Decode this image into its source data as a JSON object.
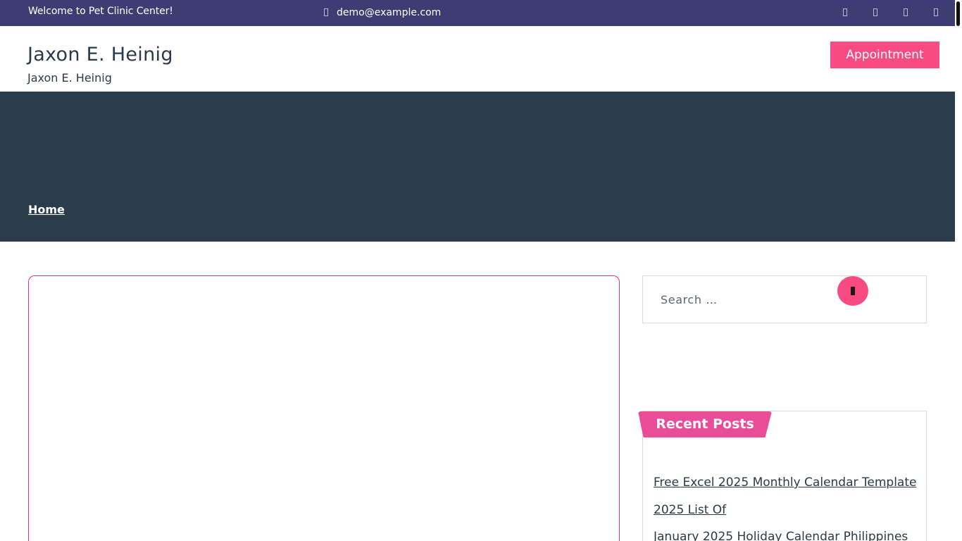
{
  "topbar": {
    "welcome": "Welcome to Pet Clinic Center!",
    "email": "demo@example.com",
    "social_icons": [
      "social-icon-1",
      "social-icon-2",
      "social-icon-3",
      "social-icon-4"
    ]
  },
  "header": {
    "site_title": "Jaxon E. Heinig",
    "tagline": "Jaxon E. Heinig",
    "appointment_label": "Appointment"
  },
  "hero": {
    "breadcrumb_home": "Home"
  },
  "sidebar": {
    "search_placeholder": "Search …",
    "recent_posts_heading": "Recent Posts",
    "recent_posts": [
      "Free Excel 2025 Monthly Calendar Template",
      "2025 List Of",
      "January 2025 Holiday Calendar Philippines"
    ]
  },
  "colors": {
    "topbar_bg": "#3d3d74",
    "hero_bg": "#2b3c4c",
    "accent_pink": "#fa4a83",
    "heading_pink": "#ea4c99",
    "card_border": "#e0308c"
  }
}
